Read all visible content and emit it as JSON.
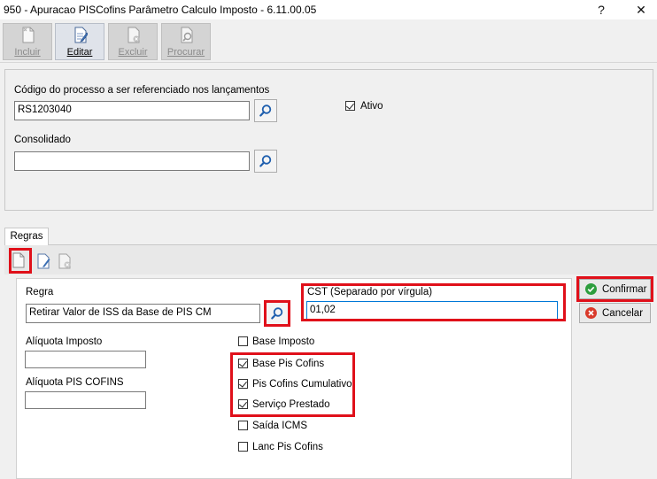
{
  "window": {
    "title": "950 - Apuracao PISCofins Parâmetro Calculo Imposto - 6.11.00.05",
    "help_glyph": "?",
    "close_glyph": "✕"
  },
  "toolbar": {
    "incluir": "Incluir",
    "editar": "Editar",
    "excluir": "Excluir",
    "procurar": "Procurar"
  },
  "header": {
    "codigo_label": "Código do processo a ser referenciado nos lançamentos",
    "codigo_value": "RS1203040",
    "ativo_label": "Ativo",
    "ativo_checked": true,
    "consolidado_label": "Consolidado",
    "consolidado_value": ""
  },
  "tabs": {
    "regras": "Regras"
  },
  "rule": {
    "regra_label": "Regra",
    "regra_value": "Retirar Valor de ISS da Base de PIS CM",
    "cst_label": "CST (Separado por vírgula)",
    "cst_value": "01,02",
    "aliquota_imposto_label": "Alíquota Imposto",
    "aliquota_imposto_value": "",
    "aliquota_pis_label": "Alíquota PIS COFINS",
    "aliquota_pis_value": "",
    "checks": {
      "base_imposto": {
        "label": "Base Imposto",
        "checked": false
      },
      "base_pis_cofins": {
        "label": "Base Pis Cofins",
        "checked": true
      },
      "pis_cofins_cumulativo": {
        "label": "Pis Cofins Cumulativo",
        "checked": true
      },
      "servico_prestado": {
        "label": "Serviço Prestado",
        "checked": true
      },
      "saida_icms": {
        "label": "Saída ICMS",
        "checked": false
      },
      "lanc_pis_cofins": {
        "label": "Lanc Pis Cofins",
        "checked": false
      }
    }
  },
  "actions": {
    "confirmar": "Confirmar",
    "cancelar": "Cancelar"
  },
  "colors": {
    "highlight": "#e0101a",
    "confirm": "#2e9e3e",
    "cancel": "#d93a2b"
  }
}
